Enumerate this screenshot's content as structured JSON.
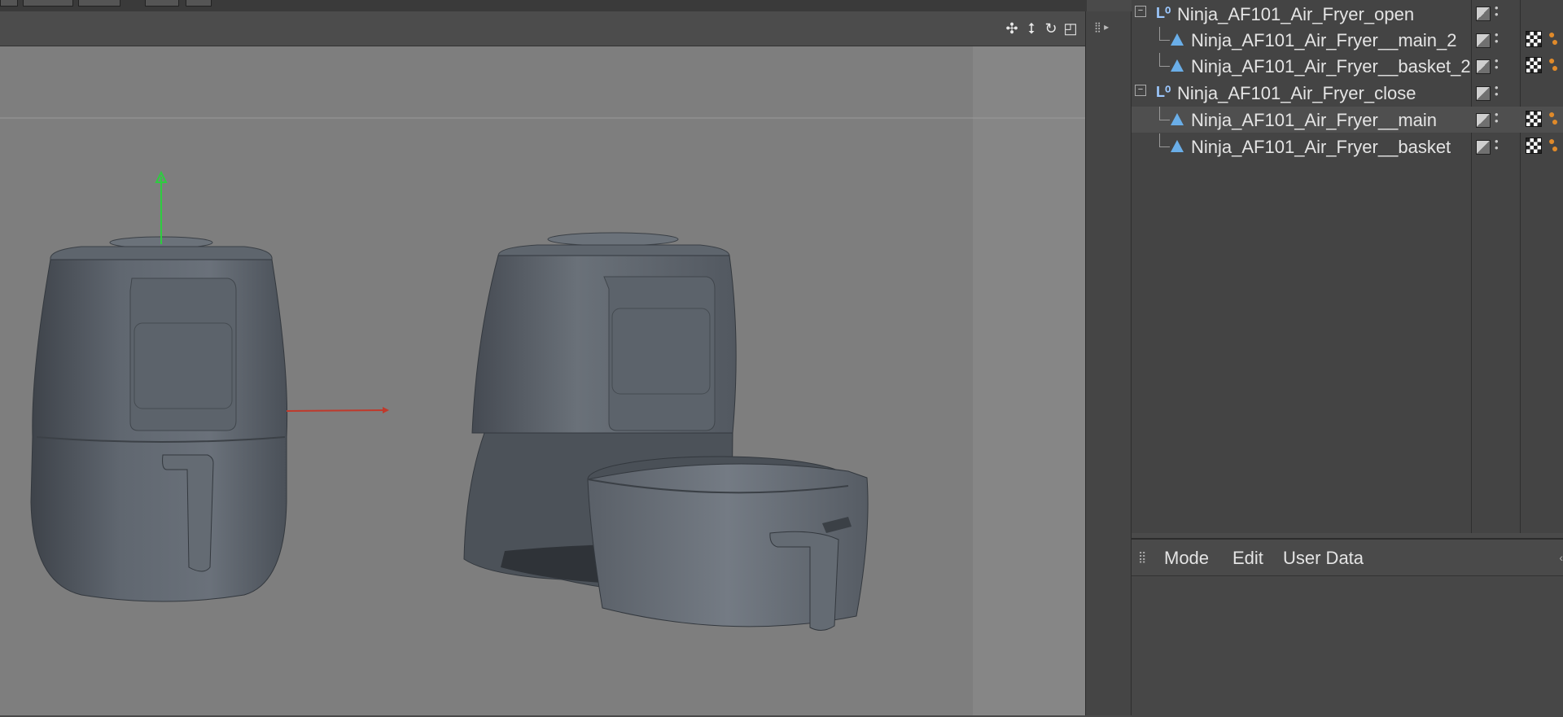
{
  "viewport": {
    "header_icons": [
      "move-icon",
      "scale-arrows-icon",
      "rotate-icon",
      "layout-icon"
    ]
  },
  "objects": {
    "items": [
      {
        "name": "Ninja_AF101_Air_Fryer_open",
        "type": "null",
        "expanded": true
      },
      {
        "name": "Ninja_AF101_Air_Fryer__main_2",
        "type": "polygon"
      },
      {
        "name": "Ninja_AF101_Air_Fryer__basket_2",
        "type": "polygon"
      },
      {
        "name": "Ninja_AF101_Air_Fryer_close",
        "type": "null",
        "expanded": true
      },
      {
        "name": "Ninja_AF101_Air_Fryer__main",
        "type": "polygon",
        "selected": true
      },
      {
        "name": "Ninja_AF101_Air_Fryer__basket",
        "type": "polygon"
      }
    ]
  },
  "attributes": {
    "menu": [
      "Mode",
      "Edit",
      "User Data"
    ]
  },
  "colors": {
    "viewport_bg": "#7b7b7b",
    "panel_bg": "#444444",
    "x_axis": "#c0392b",
    "y_axis": "#2ecc40",
    "model": "#5b6168"
  }
}
